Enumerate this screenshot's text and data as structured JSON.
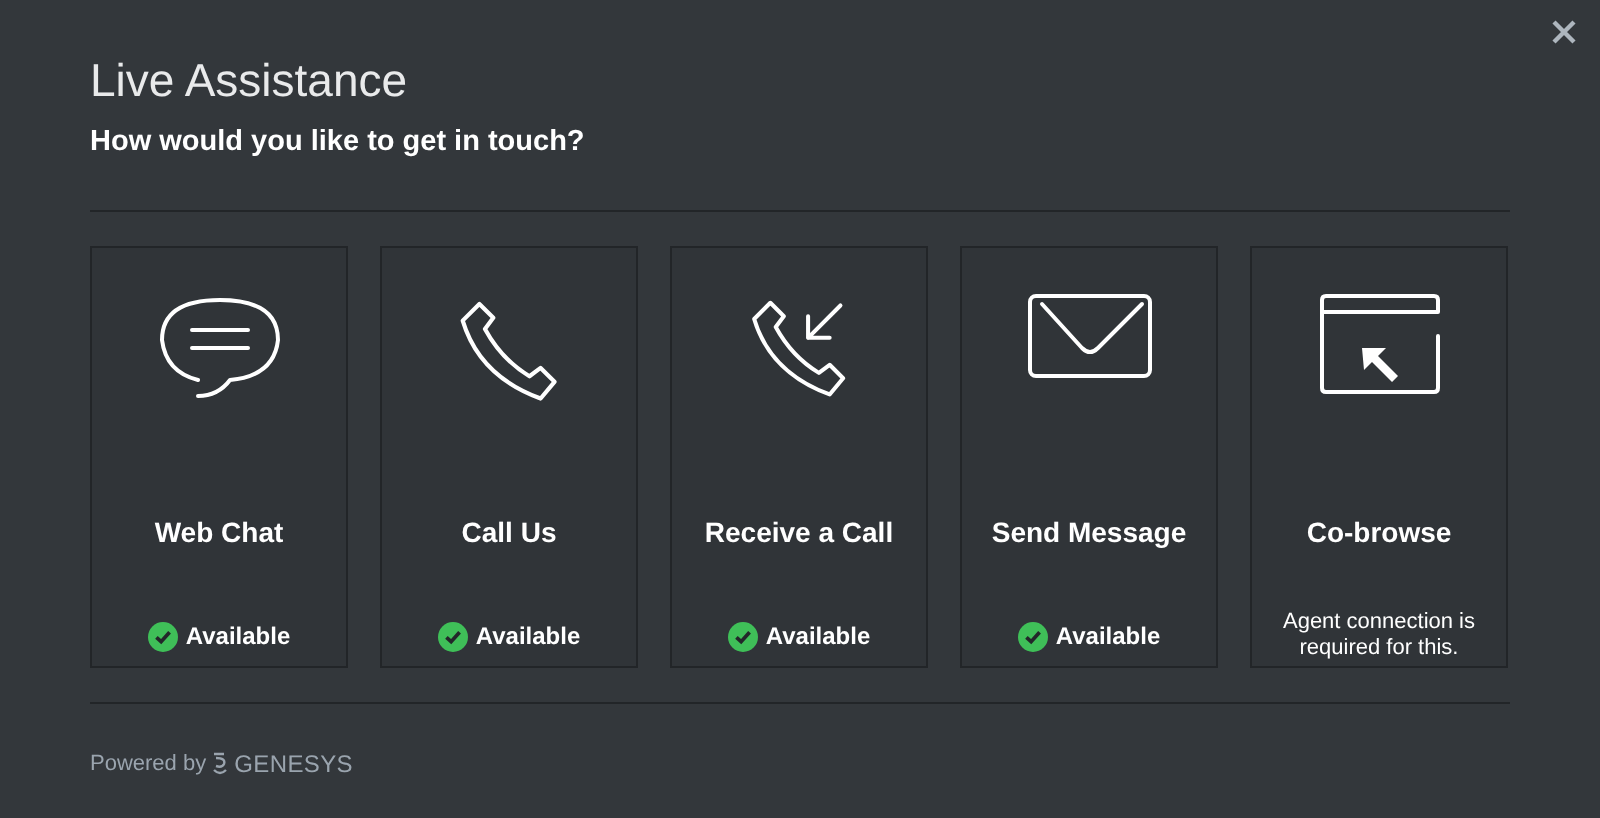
{
  "dialog": {
    "title": "Live Assistance",
    "subtitle": "How would you like to get in touch?"
  },
  "options": [
    {
      "kind": "chat",
      "label": "Web Chat",
      "status": {
        "kind": "available",
        "text": "Available"
      }
    },
    {
      "kind": "phone",
      "label": "Call Us",
      "status": {
        "kind": "available",
        "text": "Available"
      }
    },
    {
      "kind": "incoming",
      "label": "Receive a Call",
      "status": {
        "kind": "available",
        "text": "Available"
      }
    },
    {
      "kind": "mail",
      "label": "Send Message",
      "status": {
        "kind": "available",
        "text": "Available"
      }
    },
    {
      "kind": "cobrowse",
      "label": "Co-browse",
      "status": {
        "kind": "note",
        "text": "Agent connection is required for this."
      }
    }
  ],
  "footer": {
    "powered_by": "Powered by",
    "brand": "GENESYS"
  }
}
